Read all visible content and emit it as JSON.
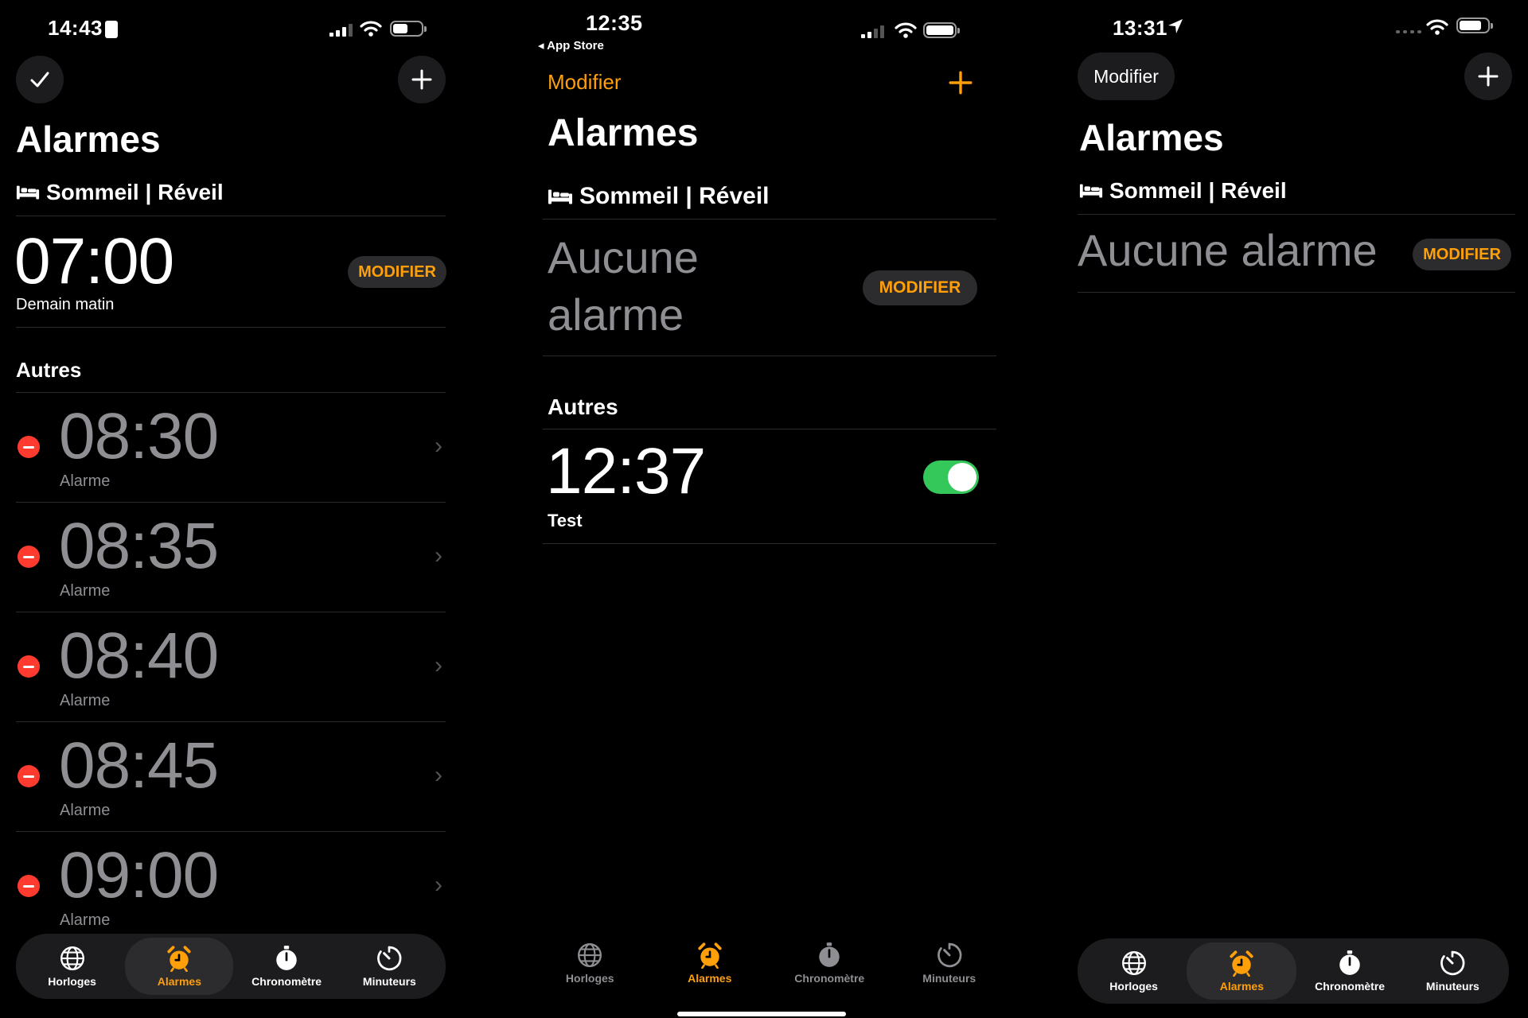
{
  "colors": {
    "accent": "#ff9f0a",
    "delete": "#ff3b30",
    "toggle_on": "#34c759",
    "background": "#000000"
  },
  "panel1": {
    "status": {
      "time": "14:43"
    },
    "header": {
      "done_icon": "checkmark-icon",
      "add_icon": "plus-icon"
    },
    "title": "Alarmes",
    "sleep": {
      "label": "Sommeil | Réveil",
      "time": "07:00",
      "sublabel": "Demain matin",
      "button": "MODIFIER"
    },
    "others_title": "Autres",
    "alarms": [
      {
        "time": "08:30",
        "label": "Alarme"
      },
      {
        "time": "08:35",
        "label": "Alarme"
      },
      {
        "time": "08:40",
        "label": "Alarme"
      },
      {
        "time": "08:45",
        "label": "Alarme"
      },
      {
        "time": "09:00",
        "label": "Alarme"
      }
    ]
  },
  "panel2": {
    "status": {
      "time": "12:35",
      "back": "◂ App Store"
    },
    "header": {
      "edit": "Modifier",
      "add_icon": "plus-icon"
    },
    "title": "Alarmes",
    "sleep": {
      "label": "Sommeil | Réveil",
      "none_line1": "Aucune",
      "none_line2": "alarme",
      "button": "MODIFIER"
    },
    "others_title": "Autres",
    "alarm": {
      "time": "12:37",
      "label": "Test",
      "enabled": true
    }
  },
  "panel3": {
    "status": {
      "time": "13:31"
    },
    "header": {
      "edit": "Modifier",
      "add_icon": "plus-icon"
    },
    "title": "Alarmes",
    "sleep": {
      "label": "Sommeil | Réveil",
      "none": "Aucune alarme",
      "button": "MODIFIER"
    }
  },
  "tabs": [
    "Horloges",
    "Alarmes",
    "Chronomètre",
    "Minuteurs"
  ],
  "active_tab": "Alarmes"
}
